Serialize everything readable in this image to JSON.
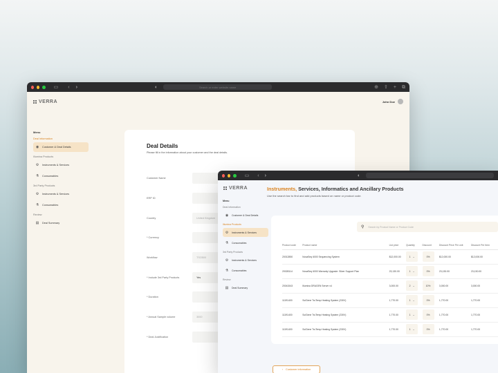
{
  "window1": {
    "url": "Search or enter website name",
    "brand": "VERRA",
    "user_name": "John Doe",
    "menu_title": "Menu",
    "sections": [
      {
        "title": "Deal Information",
        "active": true,
        "items": [
          {
            "label": "Customer & Deal Details",
            "icon": "user-icon",
            "active": true
          }
        ]
      },
      {
        "title": "Illumina Products",
        "active": false,
        "items": [
          {
            "label": "Instruments & Services",
            "icon": "instrument-icon",
            "active": false
          },
          {
            "label": "Consumables",
            "icon": "consumables-icon",
            "active": false
          }
        ]
      },
      {
        "title": "3rd Party Products",
        "active": false,
        "items": [
          {
            "label": "Instruments & Services",
            "icon": "instrument-icon",
            "active": false
          },
          {
            "label": "Consumables",
            "icon": "consumables-icon",
            "active": false
          }
        ]
      },
      {
        "title": "Review",
        "active": false,
        "items": [
          {
            "label": "Deal Summary",
            "icon": "document-icon",
            "active": false
          }
        ]
      }
    ],
    "form": {
      "title": "Deal Details",
      "subtitle": "Please fill in the information about your customer and the deal details.",
      "fields": [
        {
          "label": "Customer Name",
          "value": ""
        },
        {
          "label": "ERP ID",
          "value": ""
        },
        {
          "label": "Country",
          "value": "United Kingdom"
        },
        {
          "label": "* Currency",
          "value": ""
        },
        {
          "label": "Workflow",
          "value": "TSO500"
        },
        {
          "label": "* Include 3rd Party Products",
          "value": "Yes"
        },
        {
          "label": "* Duration",
          "value": ""
        },
        {
          "label": "* Annual Sample volume",
          "value": "3000"
        },
        {
          "label": "* Deal Justification",
          "value": ""
        }
      ]
    }
  },
  "window2": {
    "brand": "VERRA",
    "menu_title": "Menu",
    "sections": [
      {
        "title": "Deal Information",
        "active": false,
        "items": [
          {
            "label": "Customer & Deal Details",
            "icon": "user-icon",
            "active": false
          }
        ]
      },
      {
        "title": "Illumina Products",
        "active": true,
        "items": [
          {
            "label": "Instruments & Services",
            "icon": "instrument-icon",
            "active": true
          },
          {
            "label": "Consumables",
            "icon": "consumables-icon",
            "active": false
          }
        ]
      },
      {
        "title": "3rd Party Products",
        "active": false,
        "items": [
          {
            "label": "Instruments & Services",
            "icon": "instrument-icon",
            "active": false
          },
          {
            "label": "Consumables",
            "icon": "consumables-icon",
            "active": false
          }
        ]
      },
      {
        "title": "Review",
        "active": false,
        "items": [
          {
            "label": "Deal Summary",
            "icon": "document-icon",
            "active": false
          }
        ]
      }
    ],
    "page": {
      "title_accent": "Instruments,",
      "title_rest": " Services, Informatics and Ancillary Products",
      "subtitle": "Use the search bar to find and add products based on name or product code.",
      "search_placeholder": "Search by Product Name or Product Code"
    },
    "table": {
      "headers": [
        "Product code",
        "Product name",
        "List price",
        "Quantity",
        "Discount",
        "Discount Price Per unit",
        "Discount Per Item"
      ],
      "rows": [
        {
          "code": "20012850",
          "name": "NovaSeq 6000 Sequencing System",
          "price": "$12,000.00",
          "qty": "1",
          "discount": "0%",
          "unit": "$12,000.00",
          "item": "$12,000.00"
        },
        {
          "code": "20028114",
          "name": "NovaSeq 6000 Warranty Upgrade: Silver Support Plan",
          "price": "23,130.00",
          "qty": "1",
          "discount": "0%",
          "unit": "23,130.00",
          "item": "23,130.00"
        },
        {
          "code": "20041543",
          "name": "Illumina DRAGEN Server v4",
          "price": "3,000.00",
          "qty": "2",
          "discount": "10%",
          "unit": "3,000.00",
          "item": "3,000.00"
        },
        {
          "code": "11191400",
          "name": "SciGene TruTemp Heating System (230V)",
          "price": "1,770.00",
          "qty": "1",
          "discount": "0%",
          "unit": "1,770.00",
          "item": "1,770.00"
        },
        {
          "code": "11191400",
          "name": "SciGene TruTemp Heating System (230V)",
          "price": "1,770.00",
          "qty": "1",
          "discount": "0%",
          "unit": "1,770.00",
          "item": "1,770.00"
        },
        {
          "code": "11191400",
          "name": "SciGene TruTemp Heating System (230V)",
          "price": "1,770.00",
          "qty": "1",
          "discount": "0%",
          "unit": "1,770.00",
          "item": "1,770.00"
        }
      ]
    },
    "back_label": "Customer information"
  }
}
